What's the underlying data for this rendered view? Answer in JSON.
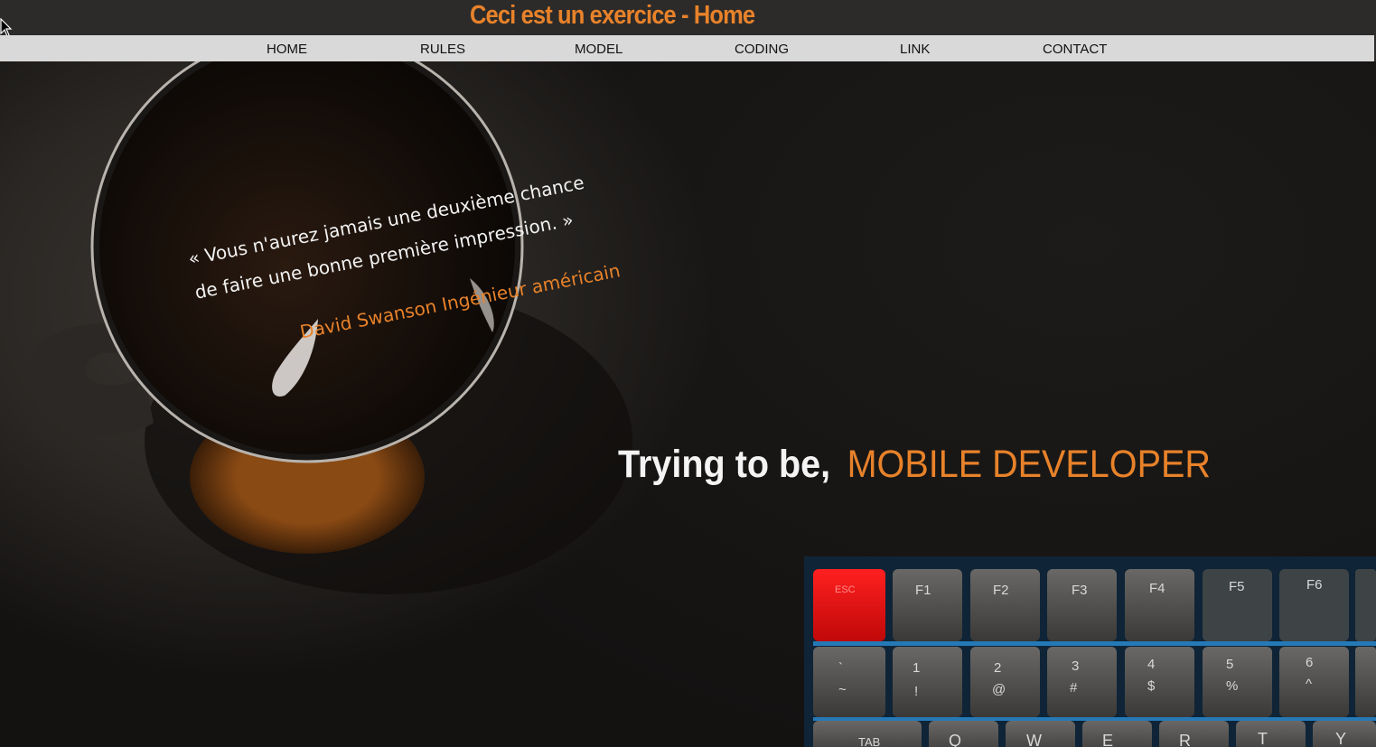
{
  "header": {
    "title": "Ceci est un exercice - Home"
  },
  "nav": {
    "items": [
      {
        "label": "HOME"
      },
      {
        "label": "RULES"
      },
      {
        "label": "MODEL"
      },
      {
        "label": "CODING"
      },
      {
        "label": "LINK"
      },
      {
        "label": "CONTACT"
      }
    ]
  },
  "hero": {
    "quote_line1": "« Vous n'aurez jamais une deuxième chance",
    "quote_line2": "de faire une bonne première impression. »",
    "quote_author": "David Swanson Ingénieur américain",
    "tagline_prefix": "Trying to be,",
    "tagline_role": "MOBILE DEVELOPER",
    "keyboard": {
      "function_row": [
        "ESC",
        "F1",
        "F2",
        "F3",
        "F4",
        "F5",
        "F6"
      ],
      "number_row": [
        "`",
        "1",
        "2",
        "3",
        "4",
        "5",
        "6"
      ],
      "number_row_shift": [
        "~",
        "!",
        "@",
        "#",
        "$",
        "%",
        "^"
      ],
      "letter_row": [
        "TAB",
        "Q",
        "W",
        "E",
        "R",
        "T",
        "Y"
      ]
    }
  },
  "colors": {
    "accent": "#e8822a",
    "topbar": "#2c2b2a",
    "navbar": "#d9d9d9",
    "esc_key": "#e01010",
    "key_glow": "#2a8fd8"
  }
}
